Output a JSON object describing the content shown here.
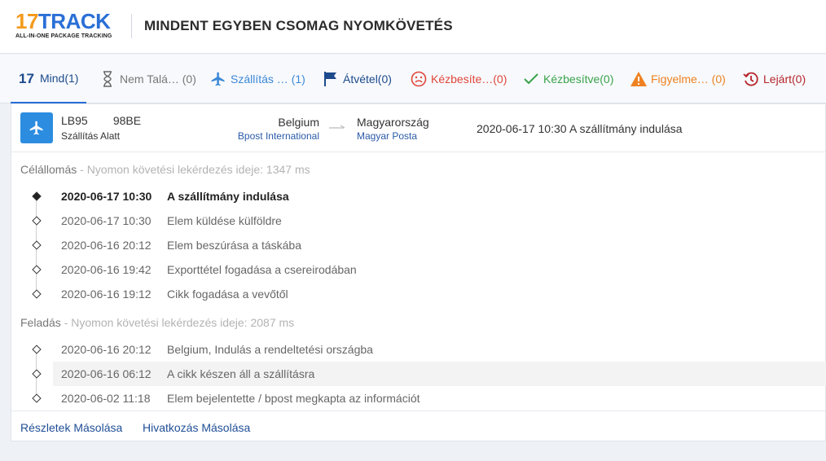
{
  "header": {
    "logo_main_num": "17",
    "logo_main_word": "TRACK",
    "logo_sub": "ALL-IN-ONE PACKAGE TRACKING",
    "title": "MINDENT EGYBEN CSOMAG NYOMKÖVETÉS"
  },
  "tabs": [
    {
      "label": "Mind(1)",
      "icon": "17-logo-icon",
      "color": "#1d4a8c",
      "active": true
    },
    {
      "label": "Nem Talá… (0)",
      "icon": "hourglass-icon",
      "color": "#777777"
    },
    {
      "label": "Szállítás … (1)",
      "icon": "airplane-icon",
      "color": "#3b88d8"
    },
    {
      "label": "Átvétel(0)",
      "icon": "flag-icon",
      "color": "#1d4a8c"
    },
    {
      "label": "Kézbesíte…(0)",
      "icon": "sad-face-icon",
      "color": "#e0463b"
    },
    {
      "label": "Kézbesítve(0)",
      "icon": "checkmark-icon",
      "color": "#3aa24b"
    },
    {
      "label": "Figyelme… (0)",
      "icon": "warning-icon",
      "color": "#ee8221"
    },
    {
      "label": "Lejárt(0)",
      "icon": "history-icon",
      "color": "#b6262c"
    }
  ],
  "shipment": {
    "tracking_number": "LB95        98BE",
    "status": "Szállítás Alatt",
    "origin_country": "Belgium",
    "origin_carrier": "Bpost International",
    "destination_country": "Magyarország",
    "destination_carrier": "Magyar Posta",
    "latest_time": "2020-06-17 10:30",
    "latest_description": "A szállítmány indulása"
  },
  "destination_section": {
    "label": "Célállomás",
    "query_text": " - Nyomon követési lekérdezés ideje: 1347 ms",
    "events": [
      {
        "time": "2020-06-17 10:30",
        "description": "A szállítmány indulása"
      },
      {
        "time": "2020-06-17 10:30",
        "description": "Elem küldése külföldre"
      },
      {
        "time": "2020-06-16 20:12",
        "description": "Elem beszúrása a táskába"
      },
      {
        "time": "2020-06-16 19:42",
        "description": "Exporttétel fogadása a csereirodában"
      },
      {
        "time": "2020-06-16 19:12",
        "description": "Cikk fogadása a vevőtől"
      }
    ]
  },
  "origin_section": {
    "label": "Feladás",
    "query_text": " - Nyomon követési lekérdezés ideje: 2087 ms",
    "events": [
      {
        "time": "2020-06-16 20:12",
        "description": "Belgium, Indulás a rendeltetési országba"
      },
      {
        "time": "2020-06-16 06:12",
        "description": "A cikk készen áll a szállításra"
      },
      {
        "time": "2020-06-02 11:18",
        "description": "Elem bejelentette / bpost megkapta az információt"
      }
    ]
  },
  "footer": {
    "copy_details": "Részletek Másolása",
    "copy_link": "Hivatkozás Másolása"
  },
  "colors": {
    "brand_blue": "#2a6fd6",
    "brand_orange": "#f49a1c",
    "status_badge": "#2c8de0",
    "link": "#1f4e96"
  }
}
